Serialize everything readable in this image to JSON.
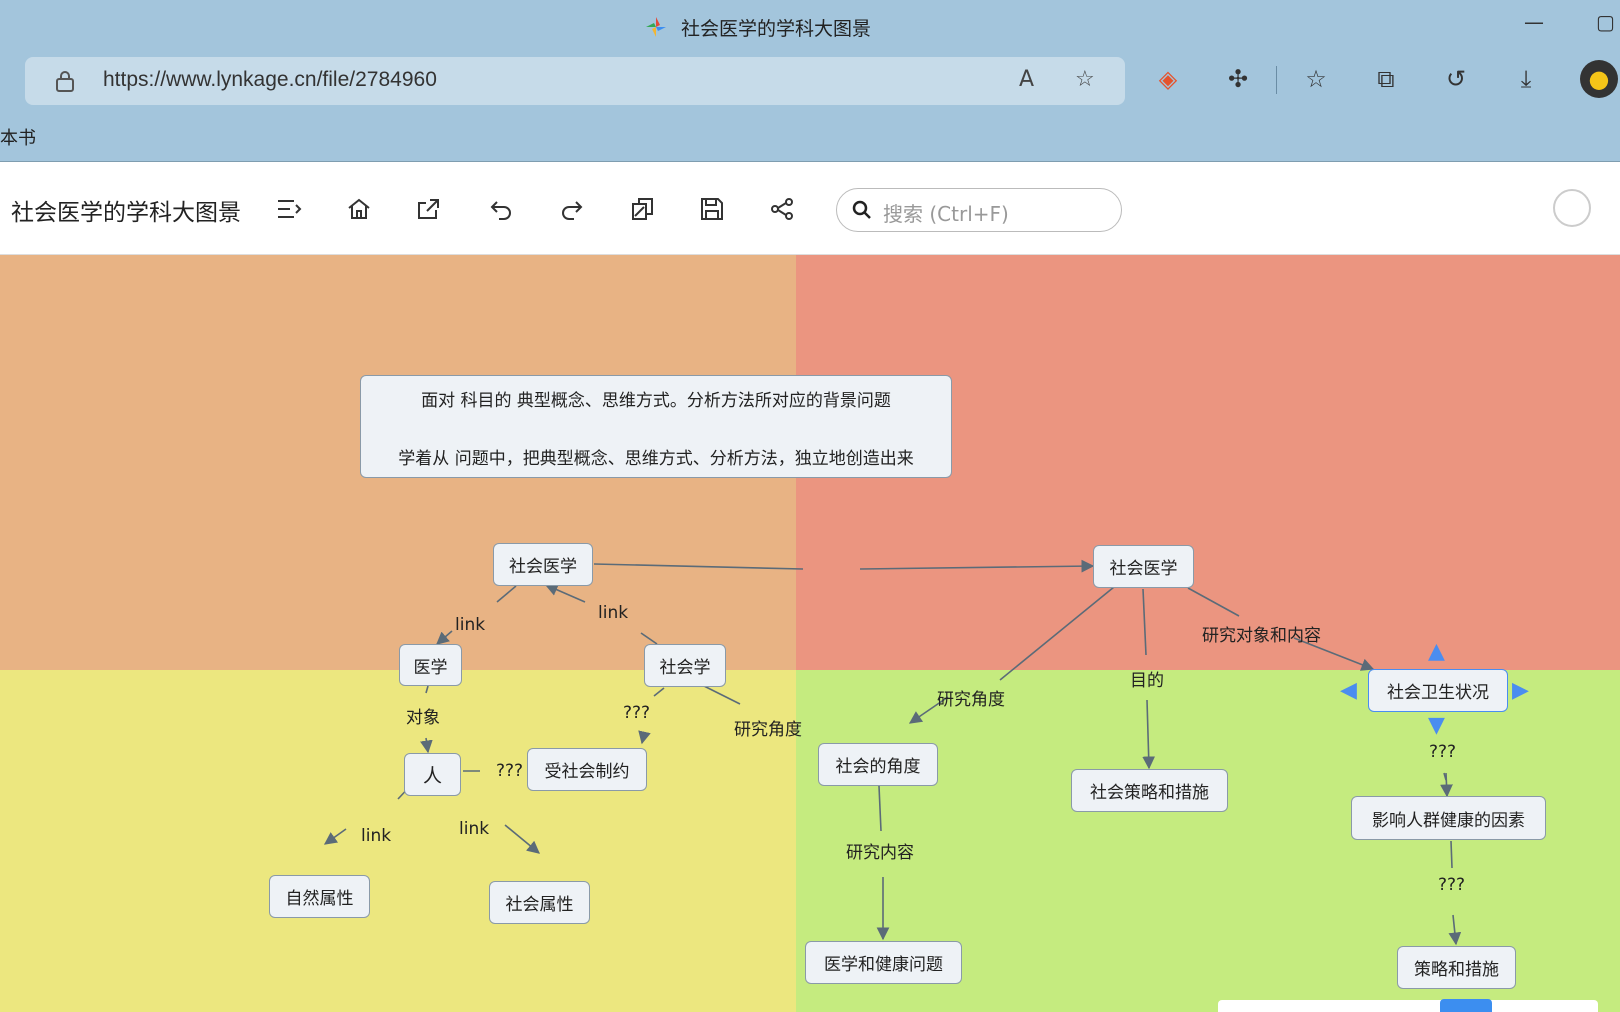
{
  "window": {
    "title": "社会医学的学科大图景"
  },
  "browser": {
    "url": "https://www.lynkage.cn/file/2784960",
    "bookmark": "本书"
  },
  "app": {
    "doc_title": "社会医学的学科大图景",
    "search_placeholder": "搜索 (Ctrl+F)"
  },
  "map": {
    "note_line1": "面对 科目的 典型概念、思维方式。分析方法所对应的背景问题",
    "note_line2": "学着从 问题中，把典型概念、思维方式、分析方法，独立地创造出来",
    "nodes": {
      "shehui_yixue_left": "社会医学",
      "yixue": "医学",
      "shehuixue": "社会学",
      "ren": "人",
      "shou_shehui": "受社会制约",
      "ziran": "自然属性",
      "shehui_shuxing": "社会属性",
      "shehui_yixue_right": "社会医学",
      "shehui_jiaodu": "社会的角度",
      "celue_cuoshi": "社会策略和措施",
      "weisheng": "社会卫生状况",
      "yingxiang": "影响人群健康的因素",
      "jiankang": "医学和健康问题",
      "celue": "策略和措施"
    },
    "labels": {
      "link1": "link",
      "link2": "link",
      "duixiang": "对象",
      "q1": "???",
      "q2": "???",
      "yanjiu_jiaodu_left": "研究角度",
      "link3": "link",
      "link4": "link",
      "yanjiu_duixiang": "研究对象和内容",
      "yanjiu_jiaodu_right": "研究角度",
      "mudi": "目的",
      "q3": "???",
      "yanjiu_neirong": "研究内容",
      "q4": "???"
    }
  }
}
